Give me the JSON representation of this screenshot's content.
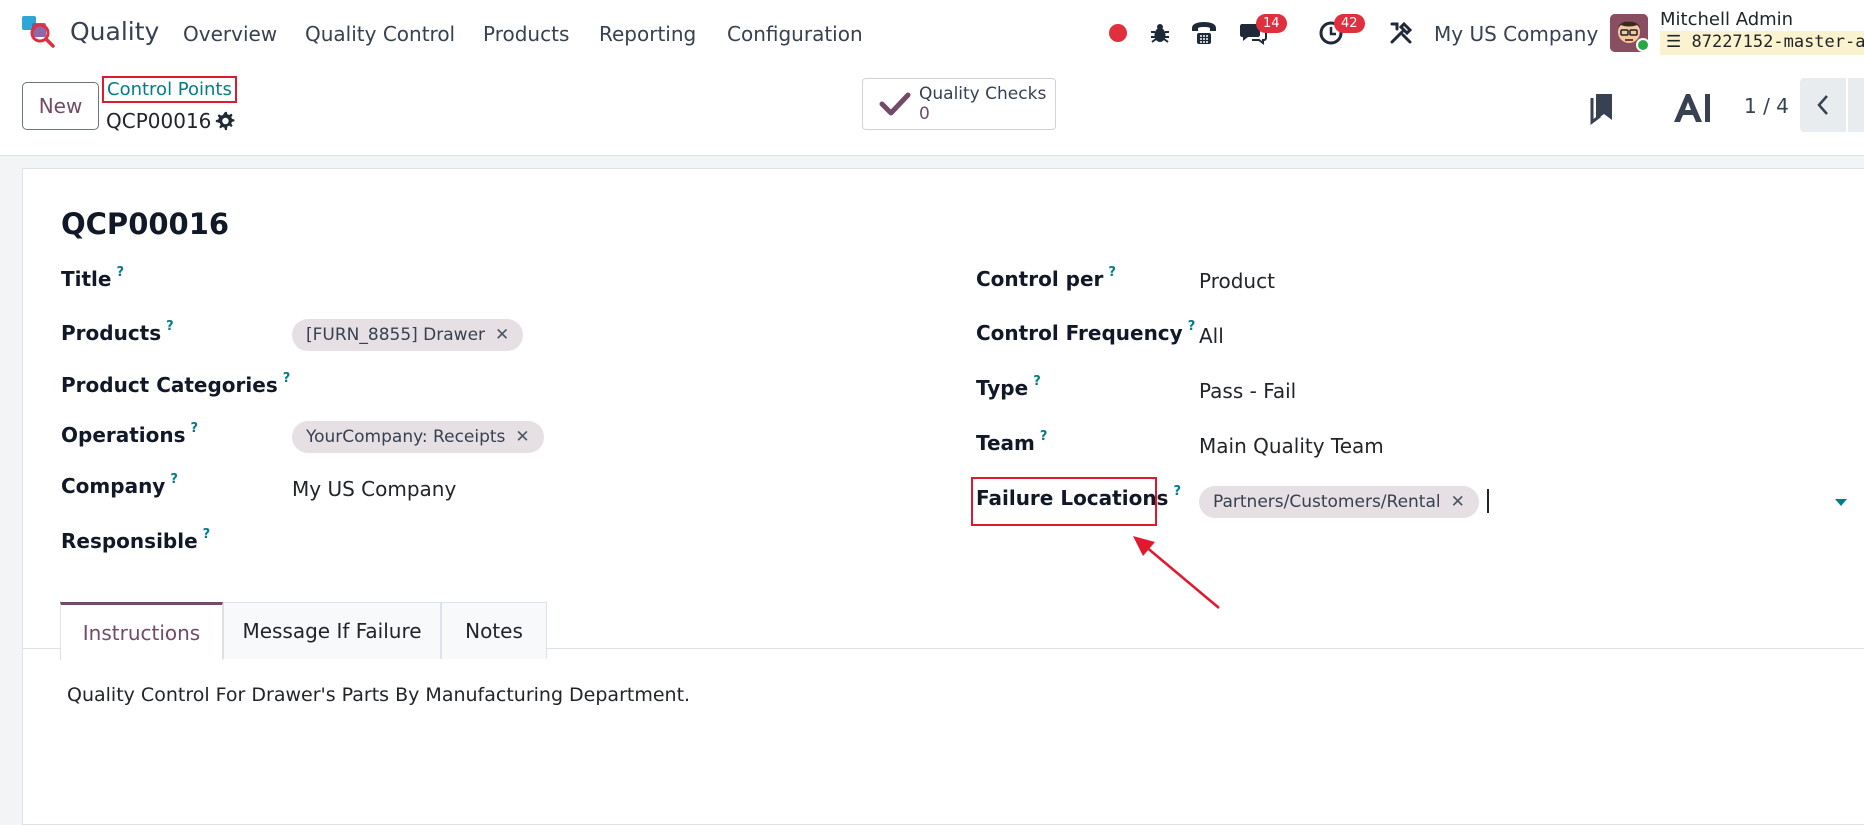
{
  "navbar": {
    "app_name": "Quality",
    "menu": [
      "Overview",
      "Quality Control",
      "Products",
      "Reporting",
      "Configuration"
    ],
    "messages_count": "14",
    "activities_count": "42",
    "company": "My US Company",
    "user_name": "Mitchell Admin",
    "db_name": "87227152-master-a"
  },
  "control_panel": {
    "new_label": "New",
    "breadcrumb": "Control Points",
    "record_name": "QCP00016",
    "smart_button": {
      "title": "Quality Checks",
      "value": "0"
    },
    "pager": "1 / 4"
  },
  "form": {
    "title": "QCP00016",
    "left": {
      "title_label": "Title",
      "products_label": "Products",
      "products_tags": [
        "[FURN_8855] Drawer"
      ],
      "categories_label": "Product Categories",
      "operations_label": "Operations",
      "operations_tags": [
        "YourCompany: Receipts"
      ],
      "company_label": "Company",
      "company_value": "My US Company",
      "responsible_label": "Responsible"
    },
    "right": {
      "control_per_label": "Control per",
      "control_per_value": "Product",
      "frequency_label": "Control Frequency",
      "frequency_value": "All",
      "type_label": "Type",
      "type_value": "Pass - Fail",
      "team_label": "Team",
      "team_value": "Main Quality Team",
      "failure_locations_label": "Failure Locations",
      "failure_locations_tags": [
        "Partners/Customers/Rental"
      ]
    },
    "help_mark": "?",
    "tabs": [
      "Instructions",
      "Message If Failure",
      "Notes"
    ],
    "active_tab": "Instructions",
    "instructions_text": "Quality Control For Drawer's Parts By Manufacturing Department."
  },
  "colors": {
    "brand": "#714b67",
    "link": "#017e84",
    "annotation": "#e0192f",
    "badge": "#e0303e"
  },
  "icons": {
    "recording": "record-dot-icon",
    "debug": "bug-icon",
    "phone": "phone-icon",
    "messages": "chat-icon",
    "activities": "clock-icon",
    "settings": "tools-icon",
    "gear": "gear-icon",
    "check": "check-icon",
    "bookmark": "bookmark-icon",
    "ai": "ai-icon",
    "prev": "chevron-left-icon"
  }
}
